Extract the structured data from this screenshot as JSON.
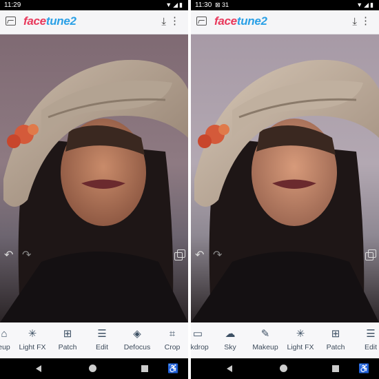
{
  "left": {
    "status": {
      "time": "11:29",
      "icons": "▼◢▮"
    },
    "appbar": {
      "logo_face": "face",
      "logo_tune": "tune2"
    },
    "tools": [
      {
        "label": "eup",
        "icon": "makeup-icon",
        "glyph": "⌂"
      },
      {
        "label": "Light FX",
        "icon": "light-fx-icon",
        "glyph": "✳"
      },
      {
        "label": "Patch",
        "icon": "patch-icon",
        "glyph": "⊞"
      },
      {
        "label": "Edit",
        "icon": "sliders-icon",
        "glyph": "☰"
      },
      {
        "label": "Defocus",
        "icon": "defocus-icon",
        "glyph": "◈"
      },
      {
        "label": "Crop",
        "icon": "crop-icon",
        "glyph": "⌗"
      }
    ]
  },
  "right": {
    "status": {
      "time": "11:30",
      "icons": "▼◢▮",
      "notifications": "⊠ 31"
    },
    "appbar": {
      "logo_face": "face",
      "logo_tune": "tune2"
    },
    "tools": [
      {
        "label": "ckdrop",
        "icon": "backdrop-icon",
        "glyph": "▭"
      },
      {
        "label": "Sky",
        "icon": "sky-icon",
        "glyph": "☁"
      },
      {
        "label": "Makeup",
        "icon": "makeup-icon",
        "glyph": "✎"
      },
      {
        "label": "Light FX",
        "icon": "light-fx-icon",
        "glyph": "✳"
      },
      {
        "label": "Patch",
        "icon": "patch-icon",
        "glyph": "⊞"
      },
      {
        "label": "Edit",
        "icon": "sliders-icon",
        "glyph": "☰"
      }
    ]
  }
}
